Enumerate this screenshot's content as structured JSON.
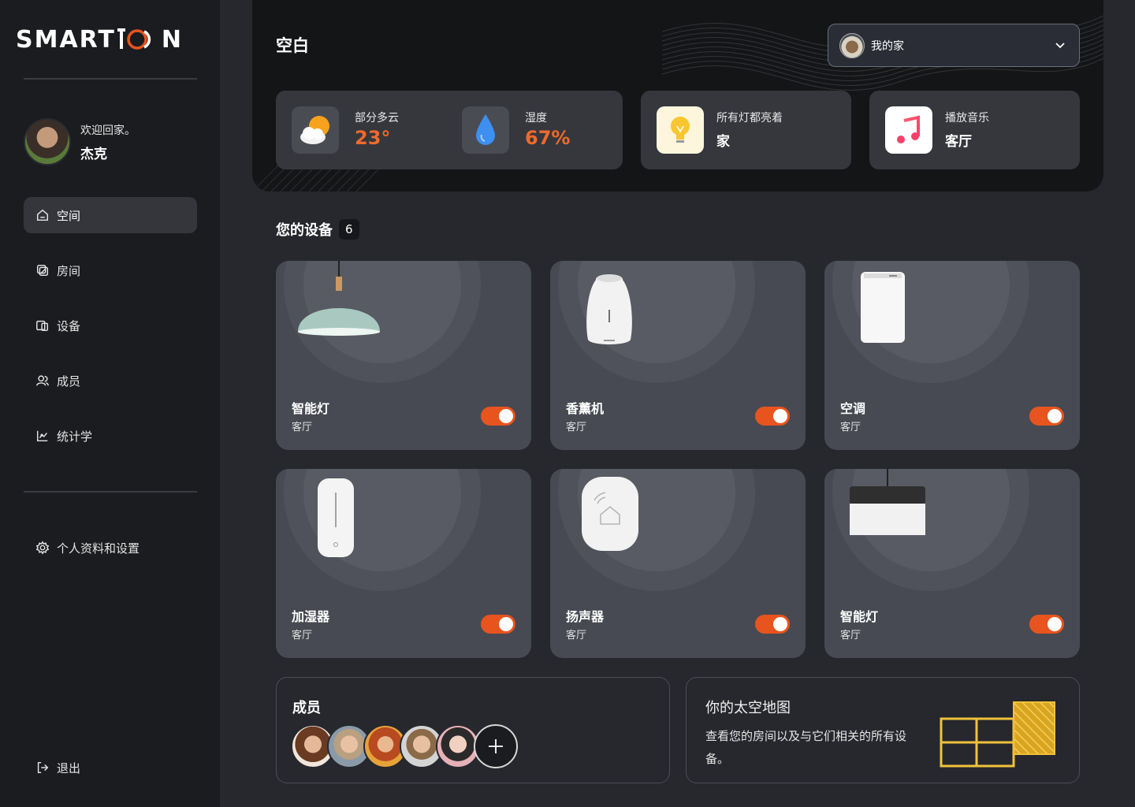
{
  "brand": {
    "logo_left": "SMART",
    "logo_right": "N",
    "accent": "#e8541e"
  },
  "profile": {
    "welcome": "欢迎回家。",
    "name": "杰克"
  },
  "nav": {
    "items": [
      {
        "label": "空间",
        "icon": "home-icon",
        "active": true
      },
      {
        "label": "房间",
        "icon": "rooms-icon",
        "active": false
      },
      {
        "label": "设备",
        "icon": "devices-icon",
        "active": false
      },
      {
        "label": "成员",
        "icon": "members-icon",
        "active": false
      },
      {
        "label": "统计学",
        "icon": "stats-icon",
        "active": false
      }
    ],
    "settings": "个人资料和设置",
    "logout": "退出"
  },
  "header": {
    "title": "空白",
    "home_select": "我的家"
  },
  "stats": {
    "weather_label": "部分多云",
    "weather_value": "23°",
    "humidity_label": "湿度",
    "humidity_value": "67%",
    "lights_label": "所有灯都亮着",
    "lights_value": "家",
    "music_label": "播放音乐",
    "music_value": "客厅"
  },
  "devices": {
    "title": "您的设备",
    "count": "6",
    "items": [
      {
        "name": "智能灯",
        "room": "客厅",
        "on": true,
        "icon": "pendant-lamp-icon"
      },
      {
        "name": "香薰机",
        "room": "客厅",
        "on": true,
        "icon": "aroma-diffuser-icon"
      },
      {
        "name": "空调",
        "room": "客厅",
        "on": true,
        "icon": "air-conditioner-icon"
      },
      {
        "name": "加湿器",
        "room": "客厅",
        "on": true,
        "icon": "humidifier-icon"
      },
      {
        "name": "扬声器",
        "room": "客厅",
        "on": true,
        "icon": "smart-speaker-icon"
      },
      {
        "name": "智能灯",
        "room": "客厅",
        "on": true,
        "icon": "ceiling-lamp-icon"
      }
    ]
  },
  "members": {
    "title": "成员"
  },
  "map": {
    "title": "你的太空地图",
    "description": "查看您的房间以及与它们相关的所有设备。"
  }
}
